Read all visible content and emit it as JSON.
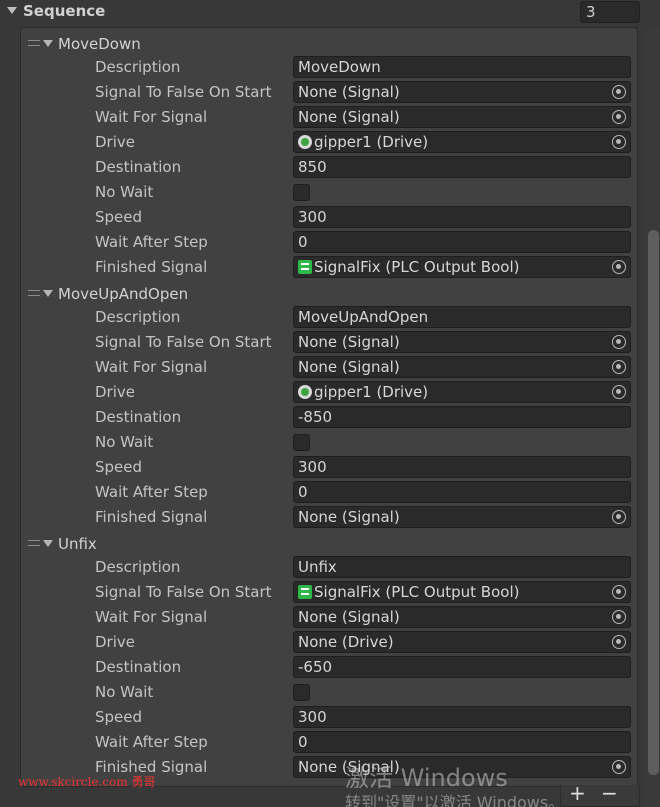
{
  "header": {
    "title": "Sequence",
    "count": "3"
  },
  "items": [
    {
      "name": "MoveDown",
      "labels": [
        "Description",
        "Signal To False On Start",
        "Wait For Signal",
        "Drive",
        "Destination",
        "No Wait",
        "Speed",
        "Wait After Step",
        "Finished Signal"
      ],
      "description": "MoveDown",
      "signal_to_false": "None (Signal)",
      "wait_for_signal": "None (Signal)",
      "drive": "gipper1 (Drive)",
      "destination": "850",
      "speed": "300",
      "wait_after_step": "0",
      "finished_signal": "SignalFix (PLC Output Bool)"
    },
    {
      "name": "MoveUpAndOpen",
      "labels": [
        "Description",
        "Signal To False On Start",
        "Wait For Signal",
        "Drive",
        "Destination",
        "No Wait",
        "Speed",
        "Wait After Step",
        "Finished Signal"
      ],
      "description": "MoveUpAndOpen",
      "signal_to_false": "None (Signal)",
      "wait_for_signal": "None (Signal)",
      "drive": "gipper1 (Drive)",
      "destination": "-850",
      "speed": "300",
      "wait_after_step": "0",
      "finished_signal": "None (Signal)"
    },
    {
      "name": "Unfix",
      "labels": [
        "Description",
        "Signal To False On Start",
        "Wait For Signal",
        "Drive",
        "Destination",
        "No Wait",
        "Speed",
        "Wait After Step",
        "Finished Signal"
      ],
      "description": "Unfix",
      "signal_to_false": "SignalFix (PLC Output Bool)",
      "wait_for_signal": "None (Signal)",
      "drive": "None (Drive)",
      "destination": "-650",
      "speed": "300",
      "wait_after_step": "0",
      "finished_signal": "None (Signal)"
    }
  ],
  "footer": {
    "add": "+",
    "remove": "−"
  },
  "overlay": {
    "site": "www.skcircle.com 勇哥",
    "activate_line1": "激活 Windows",
    "activate_line2": "转到\"设置\"以激活 Windows。"
  }
}
